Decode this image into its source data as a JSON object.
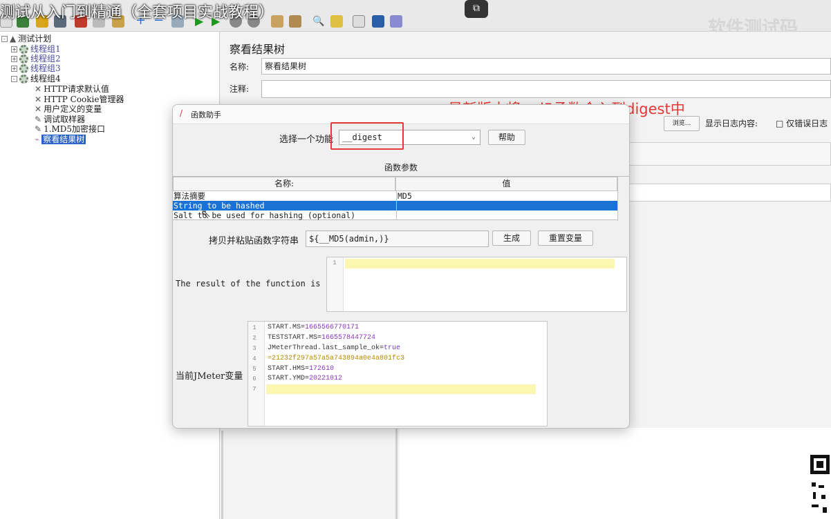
{
  "video_title": "测试从入门到精通（全套项目实战教程）",
  "watermark": "软件测试码",
  "annotation": "最新版本将md5函数合入到digest中",
  "toolbar": {
    "icons": [
      "new-icon",
      "open-icon",
      "save-icon",
      "cut-icon",
      "copy-icon",
      "paste-icon",
      "add-icon",
      "remove-icon",
      "start-icon",
      "start-no-pause-icon",
      "stop-icon",
      "shutdown-icon",
      "clear-icon",
      "clear-all-icon",
      "search-icon",
      "reset-search-icon",
      "function-helper-icon",
      "help-icon",
      "remote-icon"
    ],
    "pip_icon": "picture-in-picture-icon"
  },
  "tree": {
    "root": "测试计划",
    "groups": [
      "线程组1",
      "线程组2",
      "线程组3",
      "线程组4"
    ],
    "children": [
      "HTTP请求默认值",
      "HTTP Cookie管理器",
      "用户定义的变量",
      "调试取样器",
      "1.MD5加密接口",
      "察看结果树"
    ],
    "expanders": {
      "collapsed": "+",
      "expanded": "-"
    }
  },
  "right_panel": {
    "title": "察看结果树",
    "name_label": "名称:",
    "name_value": "察看结果树",
    "comment_label": "注释:",
    "browse_button": "浏览...",
    "log_label": "显示日志内容:",
    "errors_only": "仅错误日志"
  },
  "dialog": {
    "title": "函数助手",
    "select_label": "选择一个功能",
    "selected_function": "__digest",
    "help_button": "帮助",
    "params_title": "函数参数",
    "columns": [
      "名称:",
      "值"
    ],
    "params": [
      {
        "name": "算法摘要",
        "value": "MD5"
      },
      {
        "name": "String to be hashed",
        "value": ""
      },
      {
        "name": "Salt to be used for hashing (optional)",
        "value": ""
      }
    ],
    "copy_label": "拷贝并粘贴函数字符串",
    "copy_value": "${__MD5(admin,)}",
    "generate_button": "生成",
    "reset_button": "重置变量",
    "result_label": "The result of the function is",
    "result_line_numbers": [
      "1"
    ],
    "vars_label": "当前JMeter变量",
    "vars_lines": [
      {
        "n": "1",
        "key": "START.MS",
        "val": "1665566770171"
      },
      {
        "n": "2",
        "key": "TESTSTART.MS",
        "val": "1665578447724"
      },
      {
        "n": "3",
        "key": "JMeterThread.last_sample_ok",
        "val": "true"
      },
      {
        "n": "4",
        "key": "",
        "val": "21232f297a57a5a743894a0e4a801fc3"
      },
      {
        "n": "5",
        "key": "START.HMS",
        "val": "172610"
      },
      {
        "n": "6",
        "key": "START.YMD",
        "val": "20221012"
      },
      {
        "n": "7",
        "key": "",
        "val": ""
      }
    ]
  }
}
